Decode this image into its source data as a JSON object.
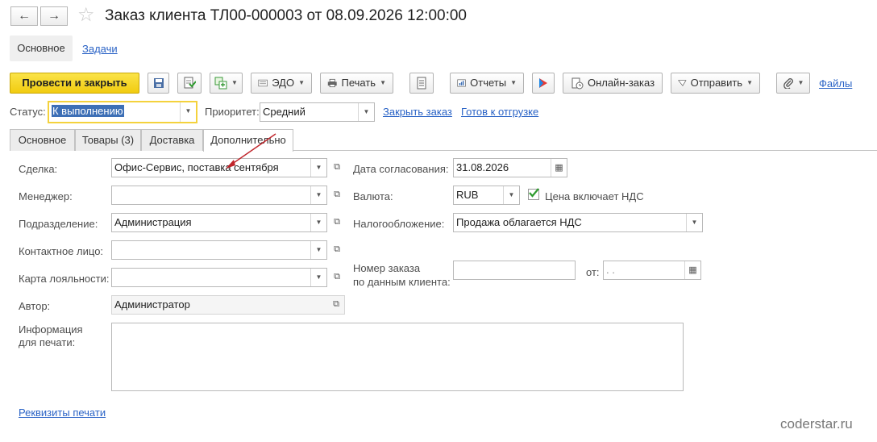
{
  "window": {
    "title": "Заказ клиента ТЛ00-000003 от 08.09.2026 12:00:00"
  },
  "nav": {
    "back": "←",
    "forward": "→",
    "favorite": "☆"
  },
  "top_tabs": {
    "main": "Основное",
    "tasks": "Задачи"
  },
  "toolbar": {
    "post_close": "Провести и закрыть",
    "edo": "ЭДО",
    "print": "Печать",
    "reports": "Отчеты",
    "online_order": "Онлайн-заказ",
    "send": "Отправить",
    "files": "Файлы"
  },
  "status_row": {
    "status_label": "Статус:",
    "status_value": "К выполнению",
    "priority_label": "Приоритет:",
    "priority_value": "Средний",
    "close_order": "Закрыть заказ",
    "ready_ship": "Готов к отгрузке"
  },
  "tabs": [
    "Основное",
    "Товары (3)",
    "Доставка",
    "Дополнительно"
  ],
  "form": {
    "deal_label": "Сделка:",
    "deal_value": "Офис-Сервис, поставка сентября",
    "manager_label": "Менеджер:",
    "manager_value": "",
    "division_label": "Подразделение:",
    "division_value": "Администрация",
    "contact_label": "Контактное лицо:",
    "contact_value": "",
    "loyalty_label": "Карта лояльности:",
    "loyalty_value": "",
    "author_label": "Автор:",
    "author_value": "Администратор",
    "print_info_label_1": "Информация",
    "print_info_label_2": "для печати:",
    "print_info_value": "",
    "agreement_date_label": "Дата согласования:",
    "agreement_date_value": "31.08.2026",
    "currency_label": "Валюта:",
    "currency_value": "RUB",
    "vat_included_label": "Цена включает НДС",
    "vat_included_checked": true,
    "taxation_label": "Налогообложение:",
    "taxation_value": "Продажа облагается НДС",
    "client_order_label_1": "Номер заказа",
    "client_order_label_2": "по данным клиента:",
    "client_order_value": "",
    "from_label": "от:",
    "from_value": " .  . ",
    "print_requisites": "Реквизиты печати"
  },
  "watermark": "coderstar.ru",
  "colors": {
    "primary_button": "#f1cc10",
    "link": "#2a63c6",
    "annotation_arrow": "#c0252b"
  }
}
